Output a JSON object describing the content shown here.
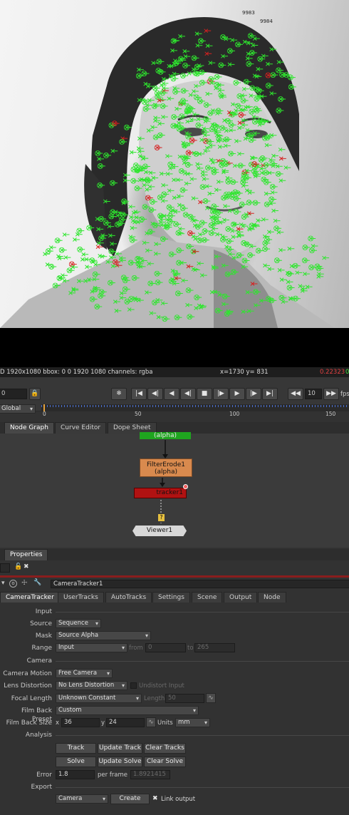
{
  "viewer": {
    "overlay_labels": [
      "9983",
      "9984"
    ],
    "info": {
      "format": "D 1920x1080 bbox: 0 0 1920 1080 channels: rgba",
      "coords": "x=1730 y= 831",
      "value_red": "0.22323",
      "value_green": "0"
    }
  },
  "transport": {
    "frame": "0",
    "fps_value": "10",
    "fps_label": "fps",
    "scope": "Global",
    "timeline_ticks": [
      "0",
      "50",
      "100",
      "150"
    ]
  },
  "node_graph_tabs": [
    "Node Graph",
    "Curve Editor",
    "Dope Sheet"
  ],
  "nodes": {
    "top_label": "(alpha)",
    "filter_erode": {
      "name": "FilterErode1",
      "sub": "(alpha)"
    },
    "camera_tracker": {
      "name": "CameraTracker1",
      "visible": "tracker1"
    },
    "viewer": {
      "name": "Viewer1"
    },
    "missing_input_mark": "?"
  },
  "properties_tab": "Properties",
  "node_name": "CameraTracker1",
  "control_tabs": [
    "CameraTracker",
    "UserTracks",
    "AutoTracks",
    "Settings",
    "Scene",
    "Output",
    "Node"
  ],
  "input": {
    "section": "Input",
    "source_label": "Source",
    "source_value": "Sequence",
    "mask_label": "Mask",
    "mask_value": "Source Alpha",
    "range_label": "Range",
    "range_value": "Input",
    "from_label": "from",
    "from_value": "0",
    "to_label": "to",
    "to_value": "265"
  },
  "camera": {
    "section": "Camera",
    "motion_label": "Camera Motion",
    "motion_value": "Free Camera",
    "lens_label": "Lens Distortion",
    "lens_value": "No Lens Distortion",
    "undistort_label": "Undistort Input",
    "focal_label": "Focal Length",
    "focal_value": "Unknown Constant",
    "length_label": "Length",
    "length_value": "50",
    "preset_label": "Film Back Preset",
    "preset_value": "Custom",
    "size_label": "Film Back Size",
    "size_x_label": "x",
    "size_x_value": "36",
    "size_y_label": "y",
    "size_y_value": "24",
    "units_label": "Units",
    "units_value": "mm"
  },
  "analysis": {
    "section": "Analysis",
    "track": "Track",
    "update_track": "Update Track",
    "clear_tracks": "Clear Tracks",
    "solve": "Solve",
    "update_solve": "Update Solve",
    "clear_solve": "Clear Solve",
    "error_label": "Error",
    "error_value": "1.8",
    "per_frame_label": "per frame",
    "per_frame_value": "1.8921415"
  },
  "export": {
    "section": "Export",
    "type_value": "Camera",
    "create": "Create",
    "link_output": "Link output"
  },
  "colors": {
    "track_good": "#2ee62e",
    "track_bad": "#d62020",
    "filter_erode_node": "#d98a4e",
    "tracker_node": "#b01212",
    "highlight_red": "#e24040"
  }
}
